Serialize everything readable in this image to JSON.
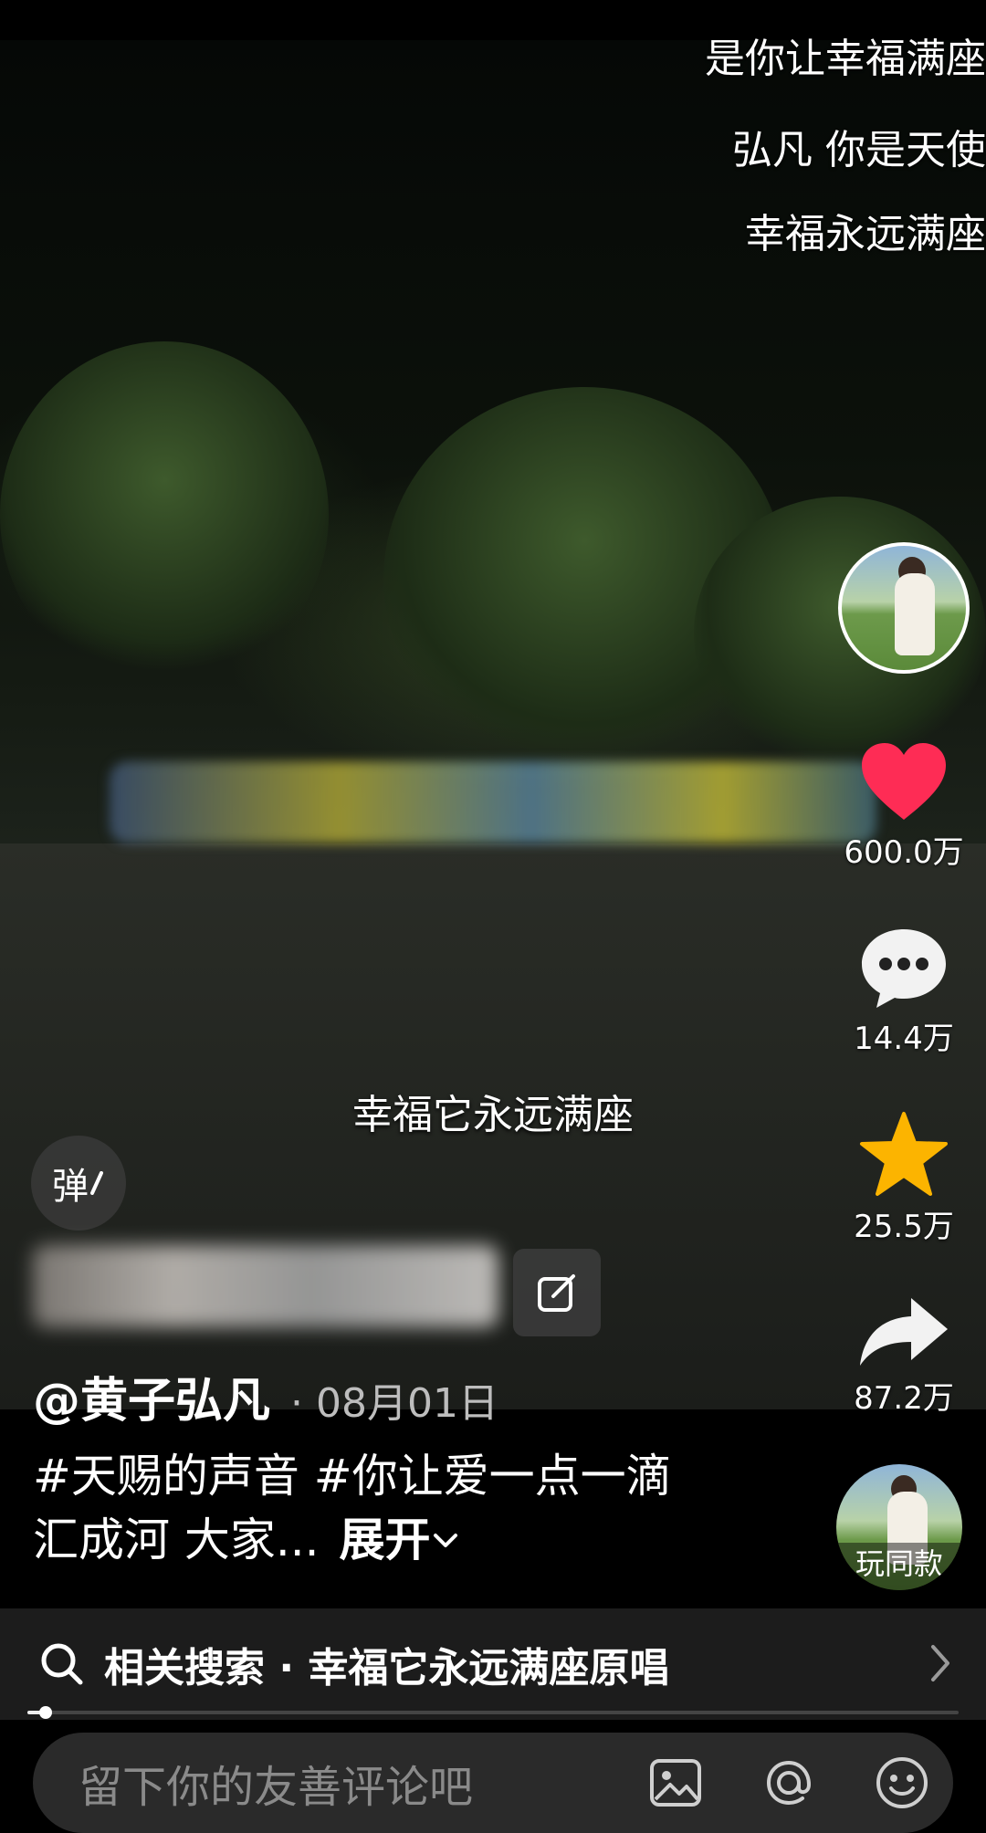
{
  "danmaku": [
    "是你让幸福满座",
    "弘凡 你是天使",
    "幸福永远满座"
  ],
  "video": {
    "subtitle": "幸福它永远满座"
  },
  "sidebar": {
    "like_count": "600.0万",
    "comment_count": "14.4万",
    "favorite_count": "25.5万",
    "share_count": "87.2万",
    "colors": {
      "like": "#fe2c55",
      "favorite": "#fcb400"
    }
  },
  "danmu_toggle_label": "弹",
  "post": {
    "author": "@黄子弘凡",
    "date": "· 08月01日",
    "caption": "#天赐的声音 #你让爱一点一滴汇成河 大家...",
    "expand_label": "展开"
  },
  "music": {
    "label": "玩同款"
  },
  "related_search": {
    "text": "相关搜索 · 幸福它永远满座原唱"
  },
  "playback": {
    "progress_fraction": 0.02
  },
  "comment_input": {
    "placeholder": "留下你的友善评论吧"
  }
}
